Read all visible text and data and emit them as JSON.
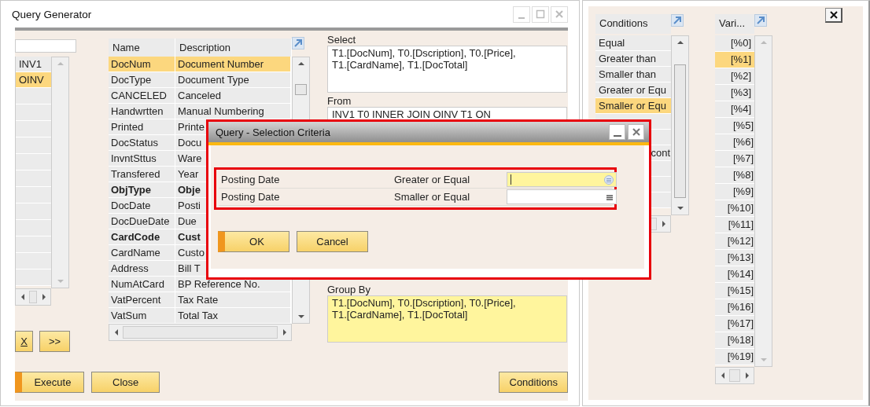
{
  "main_window": {
    "title": "Query Generator",
    "tables": [
      {
        "name": "INV1",
        "selected": false
      },
      {
        "name": "OINV",
        "selected": true
      }
    ],
    "table_buttons": [
      {
        "label": "X",
        "underlined": true
      },
      {
        "label": ">>",
        "underlined": false
      }
    ],
    "fields": {
      "columns": [
        "Name",
        "Description"
      ],
      "rows": [
        {
          "name": "DocNum",
          "description": "Document Number",
          "selected": true,
          "bold": false
        },
        {
          "name": "DocType",
          "description": "Document Type",
          "selected": false,
          "bold": false
        },
        {
          "name": "CANCELED",
          "description": "Canceled",
          "selected": false,
          "bold": false
        },
        {
          "name": "Handwrtten",
          "description": "Manual Numbering",
          "selected": false,
          "bold": false
        },
        {
          "name": "Printed",
          "description": "Printe",
          "selected": false,
          "bold": false
        },
        {
          "name": "DocStatus",
          "description": "Docu",
          "selected": false,
          "bold": false
        },
        {
          "name": "InvntSttus",
          "description": "Ware",
          "selected": false,
          "bold": false
        },
        {
          "name": "Transfered",
          "description": "Year",
          "selected": false,
          "bold": false
        },
        {
          "name": "ObjType",
          "description": "Obje",
          "selected": false,
          "bold": true
        },
        {
          "name": "DocDate",
          "description": "Posti",
          "selected": false,
          "bold": false
        },
        {
          "name": "DocDueDate",
          "description": "Due",
          "selected": false,
          "bold": false
        },
        {
          "name": "CardCode",
          "description": "Cust",
          "selected": false,
          "bold": true
        },
        {
          "name": "CardName",
          "description": "Custo",
          "selected": false,
          "bold": false
        },
        {
          "name": "Address",
          "description": "Bill T",
          "selected": false,
          "bold": false
        },
        {
          "name": "NumAtCard",
          "description": "BP Reference No.",
          "selected": false,
          "bold": false
        },
        {
          "name": "VatPercent",
          "description": "Tax Rate",
          "selected": false,
          "bold": false
        },
        {
          "name": "VatSum",
          "description": "Total Tax",
          "selected": false,
          "bold": false
        }
      ]
    },
    "clauses": [
      {
        "label": "Select",
        "value": "T1.[DocNum], T0.[Dscription], T0.[Price], T1.[CardName], T1.[DocTotal]",
        "highlighted": false
      },
      {
        "label": "From",
        "value": "INV1 T0  INNER JOIN OINV T1 ON",
        "highlighted": false
      },
      {
        "label": "Group By",
        "value": "T1.[DocNum], T0.[Dscription], T0.[Price], T1.[CardName], T1.[DocTotal]",
        "highlighted": true
      }
    ],
    "buttons": [
      {
        "label": "Execute",
        "default": true
      },
      {
        "label": "Close",
        "default": false
      },
      {
        "label": "Conditions",
        "default": false
      }
    ]
  },
  "side_panel": {
    "conditions": {
      "header": "Conditions",
      "rows": [
        {
          "text": "Equal",
          "selected": false
        },
        {
          "text": "Greater than",
          "selected": false
        },
        {
          "text": "Smaller than",
          "selected": false
        },
        {
          "text": "Greater or Equ",
          "selected": false
        },
        {
          "text": "Smaller or Equ",
          "selected": true
        },
        {
          "selected": false
        },
        {
          "selected": false
        },
        {
          "text": "cont",
          "selected": false
        },
        {
          "selected": false
        },
        {
          "selected": false
        },
        {
          "selected": false
        }
      ]
    },
    "variables": {
      "header": "Vari...",
      "rows": [
        {
          "text": "[%0]",
          "selected": false
        },
        {
          "text": "[%1]",
          "selected": true
        },
        {
          "text": "[%2]",
          "selected": false
        },
        {
          "text": "[%3]",
          "selected": false
        },
        {
          "text": "[%4]",
          "selected": false
        },
        {
          "text": "[%5]",
          "selected": false
        },
        {
          "text": "[%6]",
          "selected": false
        },
        {
          "text": "[%7]",
          "selected": false
        },
        {
          "text": "[%8]",
          "selected": false
        },
        {
          "text": "[%9]",
          "selected": false
        },
        {
          "text": "[%10]",
          "selected": false
        },
        {
          "text": "[%11]",
          "selected": false
        },
        {
          "text": "[%12]",
          "selected": false
        },
        {
          "text": "[%13]",
          "selected": false
        },
        {
          "text": "[%14]",
          "selected": false
        },
        {
          "text": "[%15]",
          "selected": false
        },
        {
          "text": "[%16]",
          "selected": false
        },
        {
          "text": "[%17]",
          "selected": false
        },
        {
          "text": "[%18]",
          "selected": false
        },
        {
          "text": "[%19]",
          "selected": false
        }
      ]
    }
  },
  "dialog": {
    "title": "Query - Selection Criteria",
    "criteria": [
      {
        "field": "Posting Date",
        "operator": "Greater or Equal",
        "focused": true
      },
      {
        "field": "Posting Date",
        "operator": "Smaller or Equal",
        "focused": false
      }
    ],
    "buttons": [
      {
        "label": "OK",
        "default": true
      },
      {
        "label": "Cancel",
        "default": false
      }
    ]
  }
}
